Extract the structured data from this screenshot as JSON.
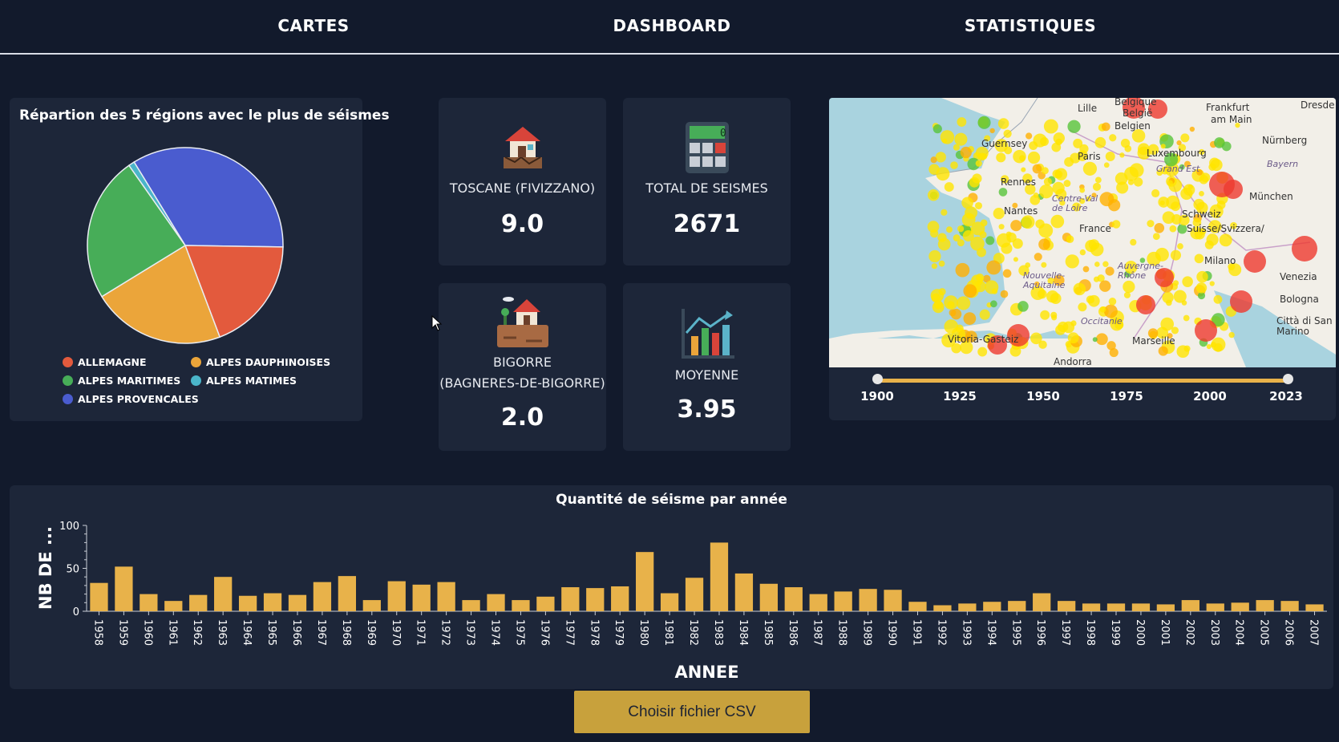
{
  "nav": {
    "items": [
      "CARTES",
      "DASHBOARD",
      "STATISTIQUES"
    ]
  },
  "pie": {
    "title": "Répartion des 5 régions avec le plus de séismes",
    "slices": [
      {
        "name": "ALPES PROVENCALES",
        "value": 34,
        "color": "#4a5ccf"
      },
      {
        "name": "ALLEMAGNE",
        "value": 19,
        "color": "#e35a3d"
      },
      {
        "name": "ALPES DAUPHINOISES",
        "value": 22,
        "color": "#eba53a"
      },
      {
        "name": "ALPES MARITIMES",
        "value": 24,
        "color": "#47ad58"
      },
      {
        "name": "ALPES MATIMES",
        "value": 1,
        "color": "#4ab5c9"
      }
    ]
  },
  "kpis": {
    "toscane": {
      "label": "TOSCANE (FIVIZZANO)",
      "value": "9.0",
      "icon": "house-earthquake-icon"
    },
    "total": {
      "label": "TOTAL DE SEISMES",
      "value": "2671",
      "icon": "calculator-icon"
    },
    "bigorre": {
      "label_line1": "BIGORRE",
      "label_line2": "(BAGNERES-DE-BIGORRE)",
      "value": "2.0",
      "icon": "house-on-ground-icon"
    },
    "moyenne": {
      "label": "MOYENNE",
      "value": "3.95",
      "icon": "bar-chart-trend-icon"
    }
  },
  "map": {
    "labels": [
      "Belgique",
      "Lille",
      "België",
      "Belgien",
      "Frankfurt",
      "am Main",
      "Dresde",
      "Guernsey",
      "Paris",
      "Luxembourg",
      "Nürnberg",
      "Grand Est",
      "Bayern",
      "Rennes",
      "Nantes",
      "Centre-Val de Loire",
      "France",
      "München",
      "Schweiz",
      "Suisse/Svizzera/",
      "Milano",
      "Venezia",
      "Nouvelle-Aquitaine",
      "Auvergne-Rhône",
      "Bologna",
      "Occitanie",
      "Città di San Marino",
      "Vitoria-Gasteiz",
      "Marseille",
      "Andorra"
    ],
    "slider": {
      "min": 1900,
      "max": 2023,
      "ticks": [
        "1900",
        "1925",
        "1950",
        "1975",
        "2000",
        "2023"
      ]
    }
  },
  "chart_data": {
    "type": "bar",
    "title": "Quantité de séisme par année",
    "xlabel": "ANNEE",
    "ylabel": "NB DE ...",
    "ylim": [
      0,
      100
    ],
    "yticks": [
      0,
      50,
      100
    ],
    "categories": [
      "1958",
      "1959",
      "1960",
      "1961",
      "1962",
      "1963",
      "1964",
      "1965",
      "1966",
      "1967",
      "1968",
      "1969",
      "1970",
      "1971",
      "1972",
      "1973",
      "1974",
      "1975",
      "1976",
      "1977",
      "1978",
      "1979",
      "1980",
      "1981",
      "1982",
      "1983",
      "1984",
      "1985",
      "1986",
      "1987",
      "1988",
      "1989",
      "1990",
      "1991",
      "1992",
      "1993",
      "1994",
      "1995",
      "1996",
      "1997",
      "1998",
      "1999",
      "2000",
      "2001",
      "2002",
      "2003",
      "2004",
      "2005",
      "2006",
      "2007"
    ],
    "values": [
      33,
      52,
      20,
      12,
      19,
      40,
      18,
      21,
      19,
      34,
      41,
      13,
      35,
      31,
      34,
      13,
      20,
      13,
      17,
      28,
      27,
      29,
      69,
      21,
      39,
      80,
      44,
      32,
      28,
      20,
      23,
      26,
      25,
      11,
      7,
      9,
      11,
      12,
      21,
      12,
      9,
      9,
      9,
      8,
      13,
      9,
      10,
      13,
      12,
      8
    ],
    "bar_color": "#e8b24a",
    "grid": false
  },
  "button": {
    "label": "Choisir fichier CSV"
  }
}
